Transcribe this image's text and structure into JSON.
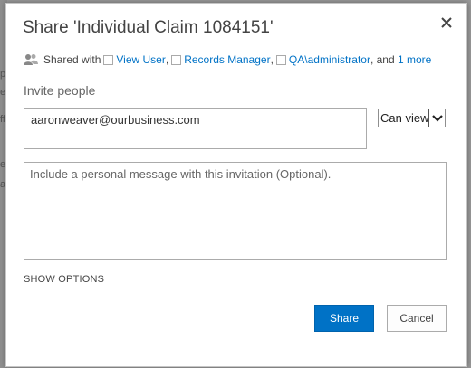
{
  "background": {
    "fragments": [
      "p",
      "e",
      "ff",
      "e",
      "a"
    ]
  },
  "dialog": {
    "title": "Share 'Individual Claim 1084151'",
    "close_icon": "close-icon",
    "shared_with": {
      "prefix": "Shared with",
      "users": [
        "View User",
        "Records Manager",
        "QA\\administrator"
      ],
      "separator": ",",
      "and_text": ", and",
      "more_link": "1 more"
    },
    "invite_label": "Invite people",
    "invite_input_value": "aaronweaver@ourbusiness.com",
    "permission_select": {
      "selected": "Can view"
    },
    "message_placeholder": "Include a personal message with this invitation (Optional).",
    "show_options": "SHOW OPTIONS",
    "share_button": "Share",
    "cancel_button": "Cancel"
  },
  "colors": {
    "accent": "#0072c6",
    "text": "#444444"
  }
}
